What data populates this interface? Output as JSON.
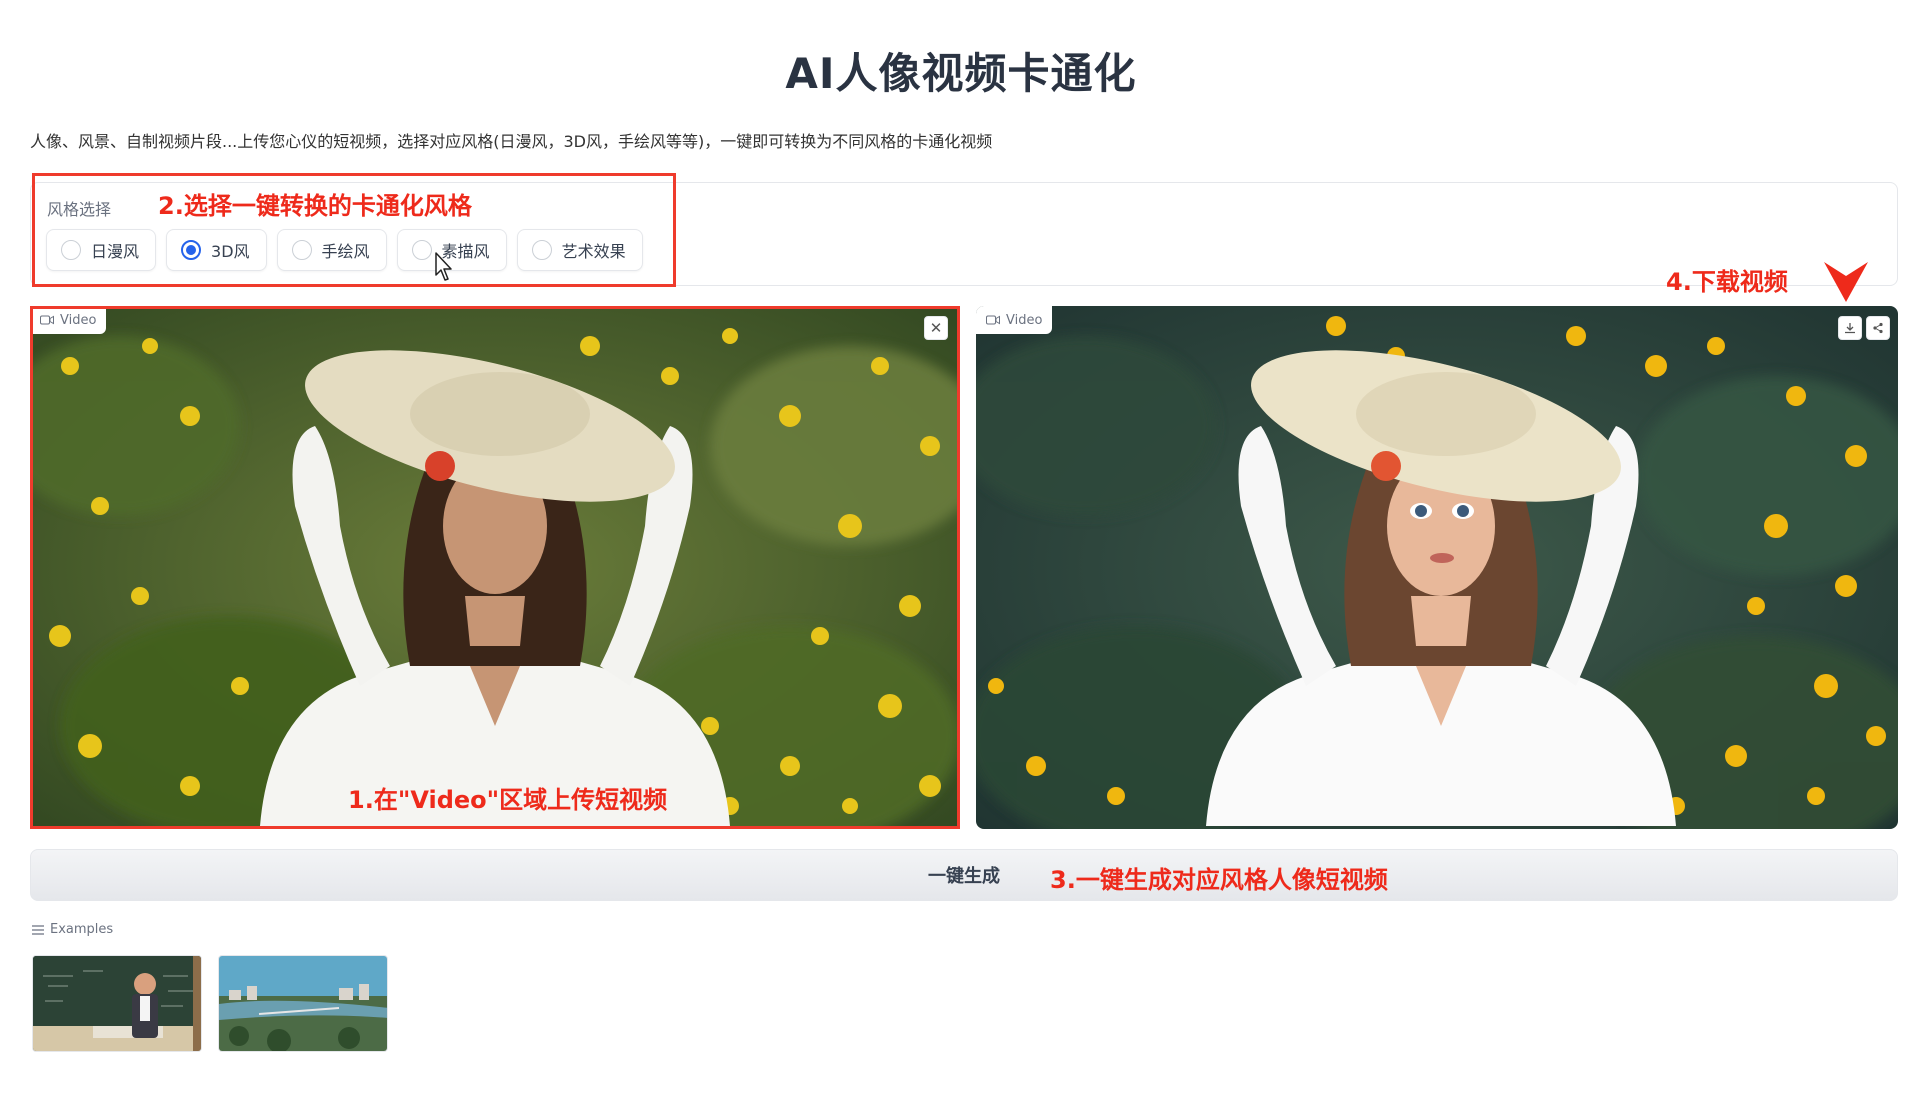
{
  "page": {
    "title": "AI人像视频卡通化",
    "description": "人像、风景、自制视频片段...上传您心仪的短视频，选择对应风格(日漫风，3D风，手绘风等等)，一键即可转换为不同风格的卡通化视频"
  },
  "style_selector": {
    "label": "风格选择",
    "options": [
      {
        "label": "日漫风",
        "selected": false
      },
      {
        "label": "3D风",
        "selected": true
      },
      {
        "label": "手绘风",
        "selected": false
      },
      {
        "label": "素描风",
        "selected": false
      },
      {
        "label": "艺术效果",
        "selected": false
      }
    ]
  },
  "input_video": {
    "label": "Video",
    "close_icon": "close-icon"
  },
  "output_video": {
    "label": "Video",
    "download_icon": "download-icon",
    "share_icon": "share-icon"
  },
  "generate_button": {
    "label": "一键生成"
  },
  "examples": {
    "label": "Examples",
    "icon": "list-icon"
  },
  "annotations": {
    "step1": "1.在\"Video\"区域上传短视频",
    "step2": "2.选择一键转换的卡通化风格",
    "step3": "3.一键生成对应风格人像短视频",
    "step4": "4.下载视频"
  },
  "colors": {
    "accent": "#2563eb",
    "annotation": "#ee2a1b"
  }
}
